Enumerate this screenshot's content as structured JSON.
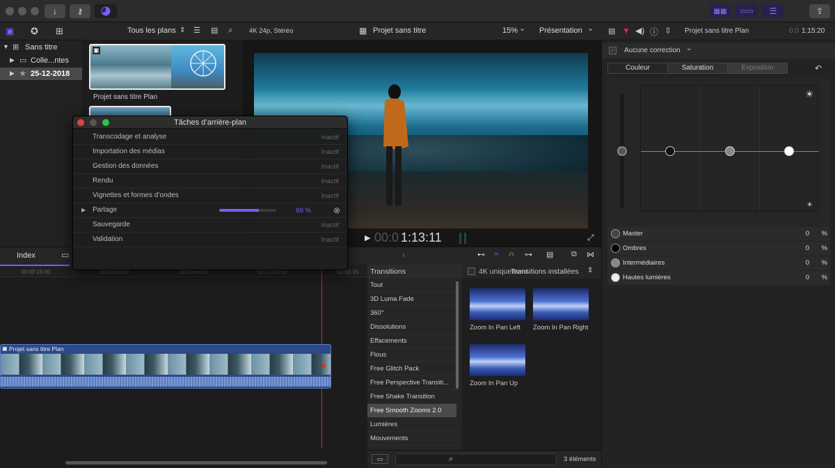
{
  "toolbar": {
    "share_icon": "share-icon"
  },
  "browser": {
    "filter_label": "Tous les plans",
    "library": [
      {
        "label": "Sans titre"
      },
      {
        "label": "Colle...ntes"
      },
      {
        "label": "25-12-2018"
      }
    ],
    "clip_label": "Projet sans titre Plan"
  },
  "viewer": {
    "format": "4K 24p, Stéréo",
    "project_title": "Projet sans titre",
    "zoom": "15%",
    "zoom_arrow": "⌄",
    "view_menu": "Présentation",
    "timecode_dim": "00:0",
    "timecode": "1:13:11"
  },
  "inspector": {
    "title": "Projet sans titre Plan",
    "timecode_dim": "0:0",
    "timecode": "1:15:20",
    "correction": "Aucune correction",
    "tabs": [
      "Couleur",
      "Saturation",
      "Exposition"
    ],
    "rows": [
      {
        "label": "Master",
        "value": "0",
        "unit": "%"
      },
      {
        "label": "Ombres",
        "value": "0",
        "unit": "%"
      },
      {
        "label": "Intermédiaires",
        "value": "0",
        "unit": "%"
      },
      {
        "label": "Hautes lumières",
        "value": "0",
        "unit": "%"
      }
    ]
  },
  "timeline": {
    "index_label": "Index",
    "ruler": [
      "00:00:15:00",
      "00:00:30:00",
      "00:00:45:00",
      "00:01:00:00",
      "00:01:15"
    ],
    "clip_label": "Projet sans titre Plan"
  },
  "effects": {
    "header": "Transitions",
    "filter": "4K uniquement",
    "category": "Transitions installées",
    "list": [
      "Tout",
      "3D Luma Fade",
      "360°",
      "Dissolutions",
      "Effacements",
      "Flous",
      "Free Glitch Pack",
      "Free Perspective Transiti...",
      "Free Shake Transition",
      "Free Smooth Zooms 2.0",
      "Lumières",
      "Mouvements"
    ],
    "selected_index": 9,
    "items": [
      "Zoom In Pan Left",
      "Zoom In Pan Right",
      "Zoom In Pan Up"
    ],
    "count": "3 éléments"
  },
  "dialog": {
    "title": "Tâches d’arrière-plan",
    "tasks": [
      {
        "name": "Transcodage et analyse",
        "status": "Inactif"
      },
      {
        "name": "Importation des médias",
        "status": "Inactif"
      },
      {
        "name": "Gestion des données",
        "status": "Inactif"
      },
      {
        "name": "Rendu",
        "status": "Inactif"
      },
      {
        "name": "Vignettes et formes d’ondes",
        "status": "Inactif"
      },
      {
        "name": "Partage",
        "status": "69 %",
        "progress": 0.69
      },
      {
        "name": "Sauvegarde",
        "status": "Inactif"
      },
      {
        "name": "Validation",
        "status": "Inactif"
      }
    ]
  },
  "colors": {
    "accent": "#7b5cff",
    "playhead": "#c33",
    "clip": "#2b4a8a"
  }
}
